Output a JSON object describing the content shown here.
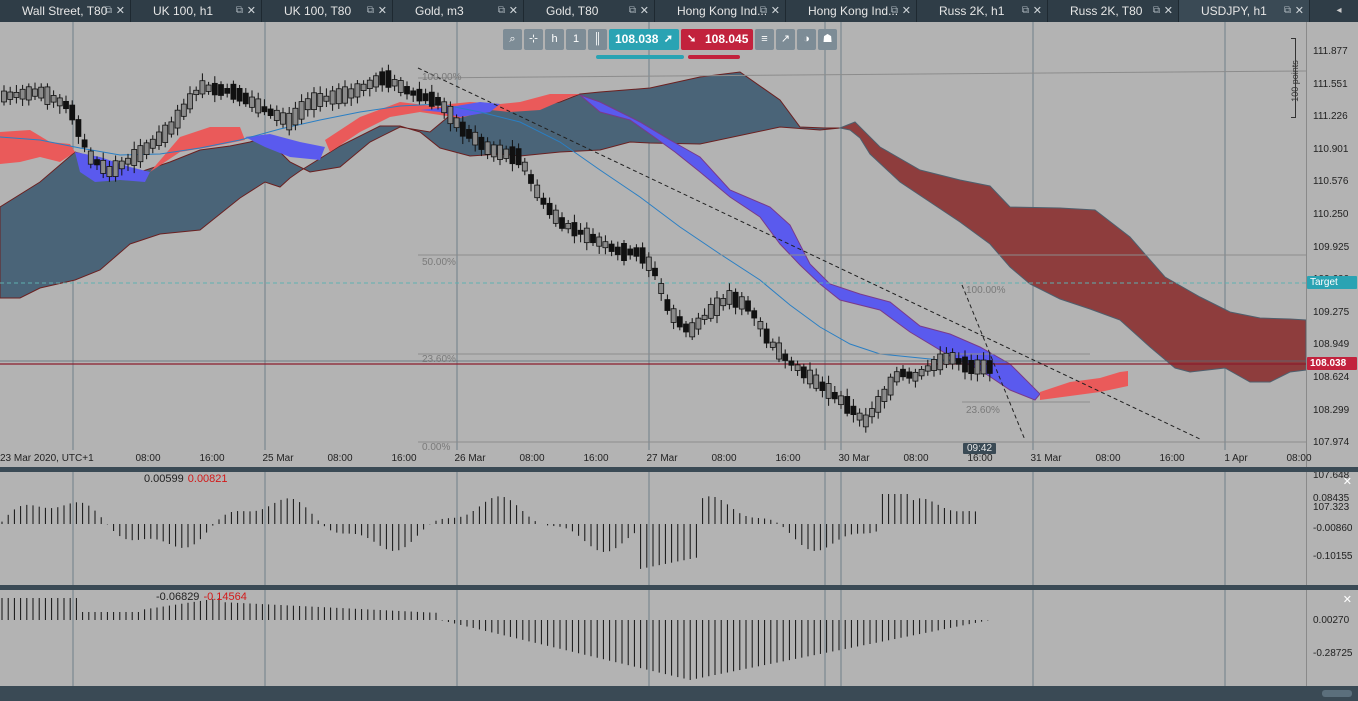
{
  "tabs": [
    {
      "label": "Wall Street, T80",
      "active": false
    },
    {
      "label": "UK 100, h1",
      "active": false
    },
    {
      "label": "UK 100, T80",
      "active": false
    },
    {
      "label": "Gold, m3",
      "active": false
    },
    {
      "label": "Gold, T80",
      "active": false
    },
    {
      "label": "Hong Kong Ind...",
      "active": false
    },
    {
      "label": "Hong Kong Ind...",
      "active": false
    },
    {
      "label": "Russ 2K, h1",
      "active": false
    },
    {
      "label": "Russ 2K, T80",
      "active": false
    },
    {
      "label": "USDJPY, h1",
      "active": true
    }
  ],
  "toolbar": {
    "bid_price": "108.038",
    "ask_price": "108.045",
    "h1_label": "h",
    "one_label": "1"
  },
  "price_axis": [
    "111.877",
    "111.551",
    "111.226",
    "110.901",
    "110.576",
    "110.250",
    "109.925",
    "109.600",
    "109.275",
    "108.949",
    "108.624",
    "108.299",
    "107.974",
    "107.648",
    "107.323"
  ],
  "tags": {
    "target": "Target",
    "current_price": "108.038"
  },
  "points_label": "100 points",
  "time_axis": [
    "23 Mar 2020, UTC+1",
    "08:00",
    "16:00",
    "25 Mar",
    "08:00",
    "16:00",
    "26 Mar",
    "08:00",
    "16:00",
    "27 Mar",
    "08:00",
    "16:00",
    "30 Mar",
    "08:00",
    "16:00",
    "31 Mar",
    "08:00",
    "16:00",
    "1 Apr",
    "08:00"
  ],
  "time_cursor": "09:42",
  "fib_labels": {
    "left_100": "100.00%",
    "left_50": "50.00%",
    "left_23": "23.60%",
    "left_0": "0.00%",
    "right_100": "100.00%",
    "right_23": "23.60%"
  },
  "indicator1": {
    "value1": "0.00599",
    "value2": "0.00821",
    "axis": [
      "0.08435",
      "-0.00860",
      "-0.10155"
    ]
  },
  "indicator2": {
    "value1": "-0.06829",
    "value2": "-0.14564",
    "axis": [
      "0.00270",
      "-0.28725"
    ]
  },
  "colors": {
    "background": "#b3b3b3",
    "bid": "#2aa3b3",
    "ask": "#c2223d",
    "cloud_bull": "#4a6478",
    "cloud_bear": "#8e3d3d",
    "blue_band": "#5a5aee",
    "red_band": "#ea5a5a"
  },
  "icons": [
    "search-icon",
    "crosshair-icon",
    "timeframe-icon",
    "candles-icon",
    "trade-arrow-icon",
    "list-icon",
    "indicators-icon",
    "drawing-icon",
    "account-icon"
  ]
}
